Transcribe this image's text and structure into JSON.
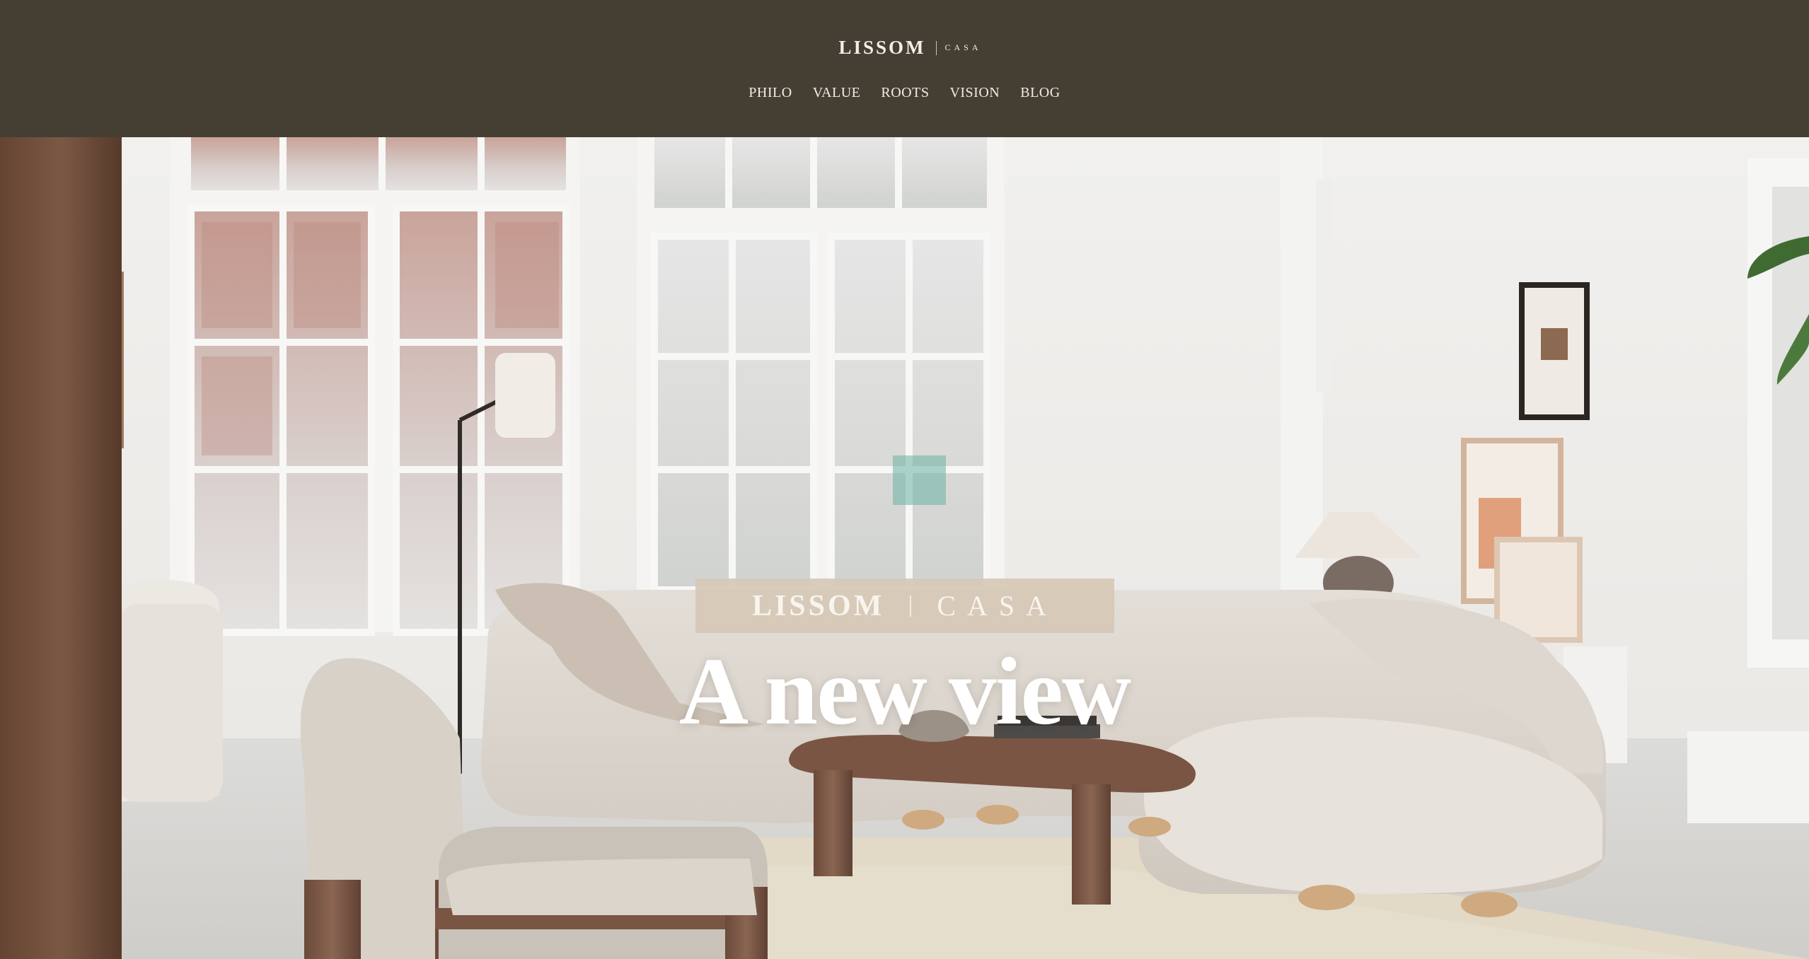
{
  "brand": {
    "name": "LISSOM",
    "sub": "CASA"
  },
  "nav": {
    "items": [
      {
        "label": "PHILO"
      },
      {
        "label": "VALUE"
      },
      {
        "label": "ROOTS"
      },
      {
        "label": "VISION"
      },
      {
        "label": "BLOG"
      }
    ]
  },
  "hero": {
    "badge_name": "LISSOM",
    "badge_sub": "CASA",
    "headline": "A new view"
  },
  "colors": {
    "header_bg": "#453e33",
    "badge_bg": "#d6c8b6",
    "text_light": "#f4efe6"
  }
}
